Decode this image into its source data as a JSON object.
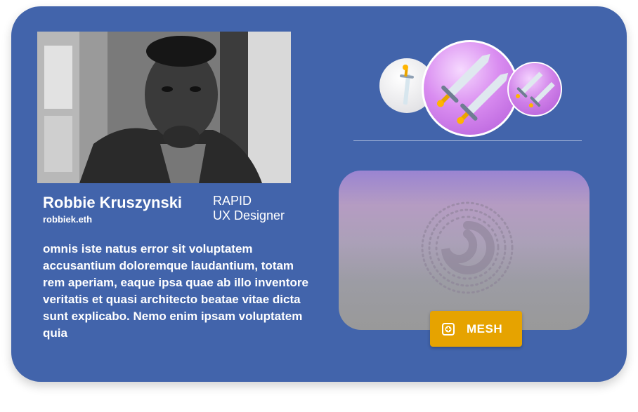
{
  "profile": {
    "name": "Robbie Kruszynski",
    "handle": "robbiek.eth",
    "role_line1": "RAPID",
    "role_line2": "UX Designer",
    "bio": "omnis iste natus error sit voluptatem accusantium doloremque laudantium, totam rem aperiam, eaque ipsa quae ab illo inventore veritatis et quasi architecto beatae vitae dicta sunt explicabo. Nemo enim ipsam voluptatem quia",
    "photo": "profile-photo-grayscale"
  },
  "badges": [
    {
      "name": "single-sword-badge",
      "icon": "sword-icon"
    },
    {
      "name": "double-sword-badge",
      "icon": "crossed-swords-icon"
    },
    {
      "name": "double-sword-badge-small",
      "icon": "crossed-swords-icon"
    }
  ],
  "mesh": {
    "button_label": "MESH",
    "button_icon": "plus-square-icon",
    "panel_icon": "swirl-icon"
  },
  "colors": {
    "card_background": "#4264ab",
    "button_background": "#e6a300",
    "badge_purple": "#c878e8"
  }
}
